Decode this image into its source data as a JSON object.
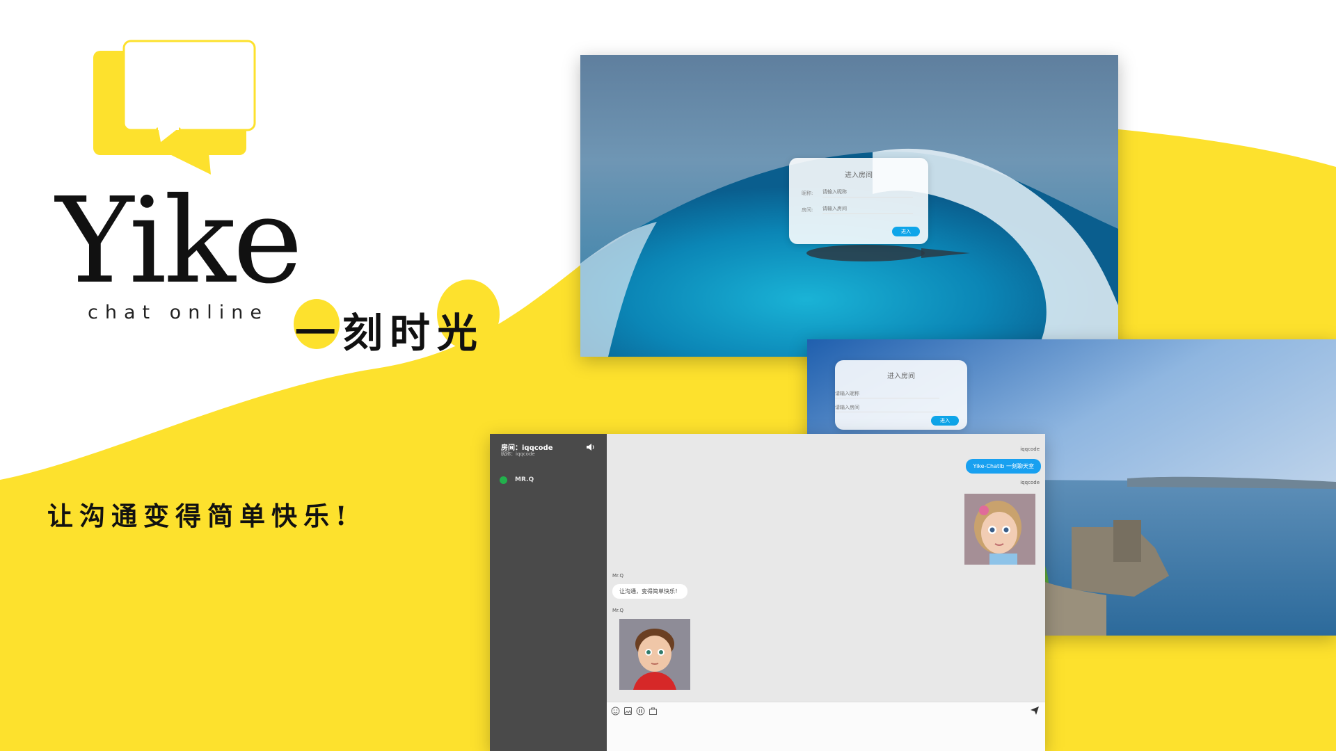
{
  "brand": {
    "name": "Yike",
    "tagline": "chat online",
    "slogan": "一刻时光",
    "motto": "让沟通变得简单快乐!"
  },
  "colors": {
    "accent_yellow": "#fde12d",
    "chat_sidebar": "#4a4a4a",
    "bubble_blue": "#18a0f0",
    "online_green": "#22b14c"
  },
  "login_ocean": {
    "title": "进入房间",
    "nick_label": "昵称:",
    "nick_placeholder": "请输入昵称",
    "room_label": "房间:",
    "room_placeholder": "请输入房间",
    "enter_button": "进入"
  },
  "login_castle": {
    "title": "进入房间",
    "nick_placeholder": "请输入昵称",
    "room_placeholder": "请输入房间",
    "enter_button": "进入"
  },
  "chat": {
    "room_title": "房间：iqqcode",
    "nickname_line": "昵称：iqqcode",
    "users": [
      {
        "name": "MR.Q",
        "status": "online"
      }
    ],
    "messages": [
      {
        "sender": "iqqcode",
        "side": "right",
        "type": "text",
        "text": "Yike-Chatlb 一刻聊天室"
      },
      {
        "sender": "iqqcode",
        "side": "right",
        "type": "image",
        "image": "girl-avatar"
      },
      {
        "sender": "Mr.Q",
        "side": "left",
        "type": "text",
        "text": "让沟通，变得简单快乐！"
      },
      {
        "sender": "Mr.Q",
        "side": "left",
        "type": "image",
        "image": "boy-avatar"
      }
    ],
    "toolbar_icons": [
      "emoji-icon",
      "image-icon",
      "file-icon",
      "bag-icon"
    ],
    "send_icon": "send-icon",
    "speaker_icon": "speaker-icon"
  }
}
